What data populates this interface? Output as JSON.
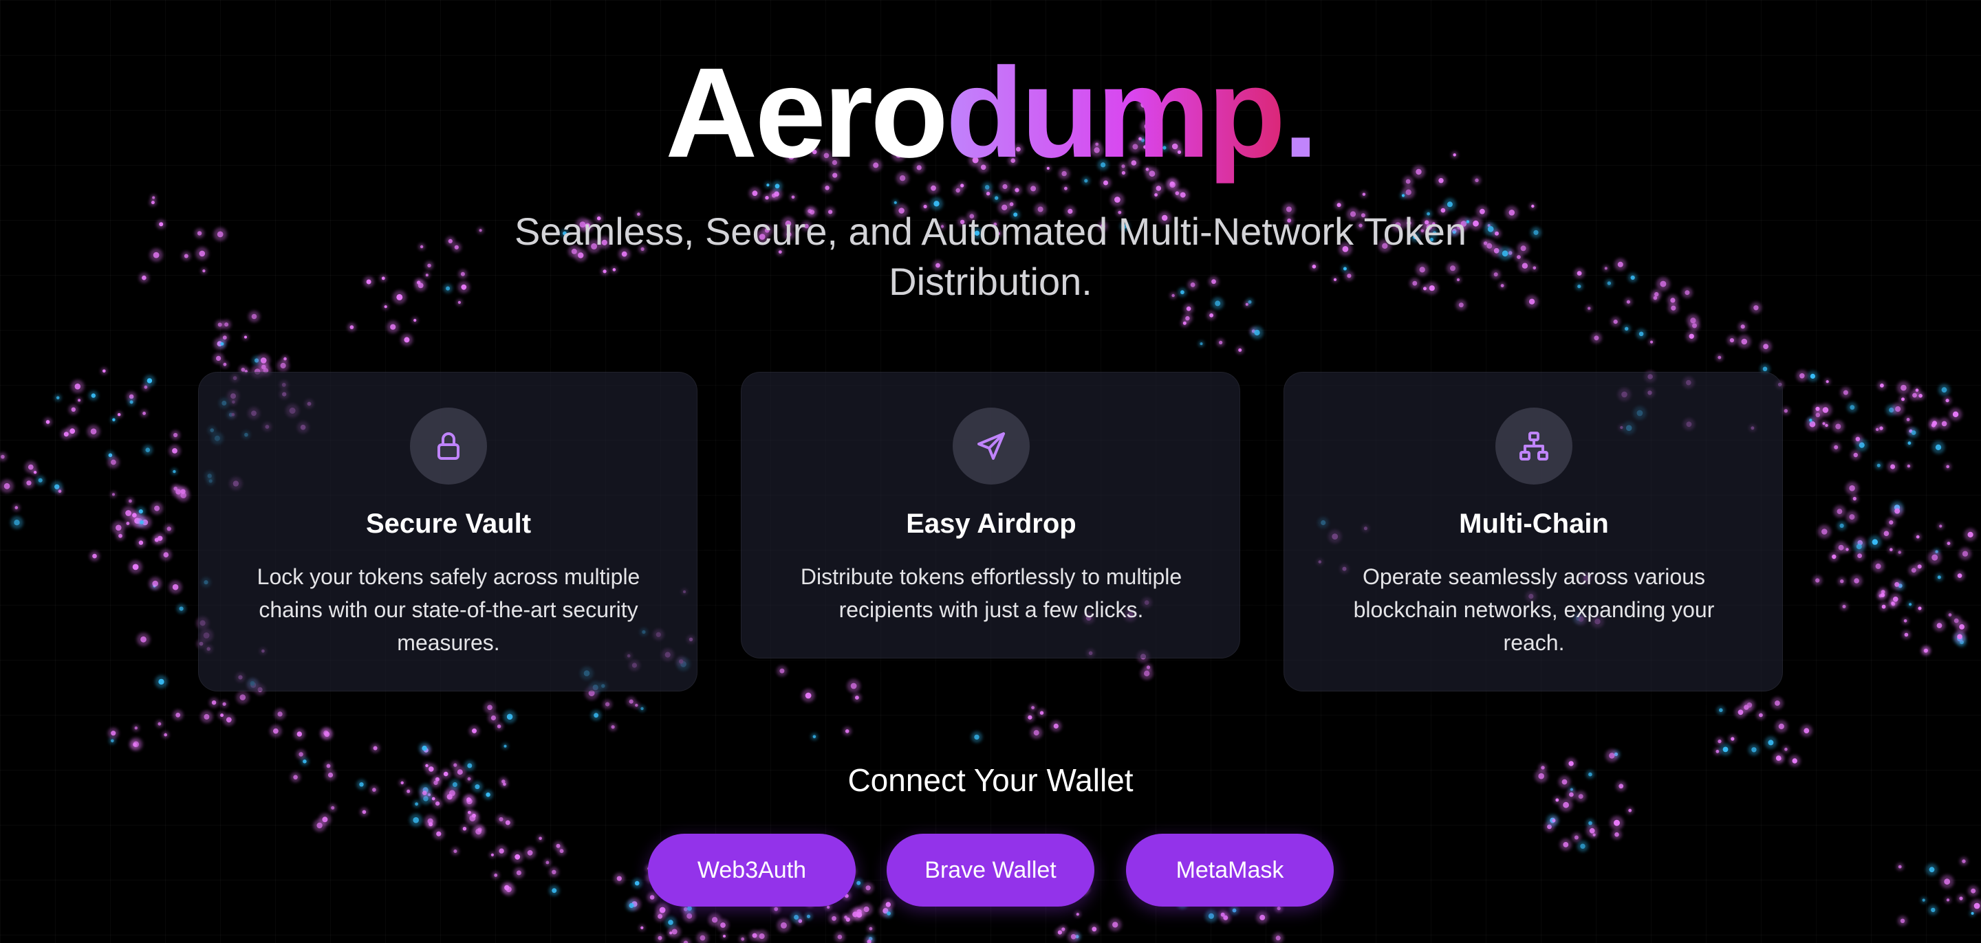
{
  "brand": {
    "prefix": "Aero",
    "highlight": "dump",
    "suffix": "."
  },
  "tagline": "Seamless, Secure, and Automated Multi-Network Token Distribution.",
  "features": [
    {
      "icon": "lock-icon",
      "title": "Secure Vault",
      "description": "Lock your tokens safely across multiple chains with our state-of-the-art security measures."
    },
    {
      "icon": "send-icon",
      "title": "Easy Airdrop",
      "description": "Distribute tokens effortlessly to multiple recipients with just a few clicks."
    },
    {
      "icon": "network-icon",
      "title": "Multi-Chain",
      "description": "Operate seamlessly across various blockchain networks, expanding your reach."
    }
  ],
  "wallet": {
    "heading": "Connect Your Wallet",
    "options": [
      "Web3Auth",
      "Brave Wallet",
      "MetaMask"
    ]
  },
  "colors": {
    "background": "#000000",
    "accent_start": "#c084fc",
    "accent_mid": "#d946ef",
    "accent_end": "#db2777",
    "button": "#9333ea",
    "card": "#1e2130",
    "particle_pink": "#e879f9",
    "particle_blue": "#38bdf8"
  }
}
